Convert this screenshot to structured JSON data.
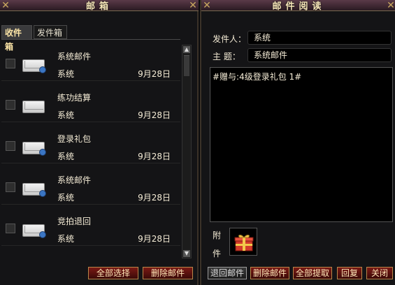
{
  "mailbox": {
    "title": "邮箱",
    "tabs": [
      {
        "label": "收件箱"
      },
      {
        "label": "发件箱"
      }
    ],
    "mails": [
      {
        "subject": "系统邮件",
        "sender": "系统",
        "date": "9月28日",
        "has_seal": true
      },
      {
        "subject": "练功结算",
        "sender": "系统",
        "date": "9月28日",
        "has_seal": false
      },
      {
        "subject": "登录礼包",
        "sender": "系统",
        "date": "9月28日",
        "has_seal": true
      },
      {
        "subject": "系统邮件",
        "sender": "系统",
        "date": "9月28日",
        "has_seal": true
      },
      {
        "subject": "竞拍退回",
        "sender": "系统",
        "date": "9月28日",
        "has_seal": true
      }
    ],
    "buttons": {
      "select_all": "全部选择",
      "delete": "删除邮件"
    }
  },
  "reader": {
    "title": "邮件阅读",
    "sender_label": "发件人：",
    "sender_value": "系统",
    "subject_label": "主 题：",
    "subject_value": "系统邮件",
    "body": "#赠与:4级登录礼包 1#",
    "attach_label_1": "附",
    "attach_label_2": "件",
    "buttons": {
      "back": "退回邮件",
      "delete": "删除邮件",
      "collect_all": "全部提取",
      "reply": "回复",
      "close": "关闭"
    }
  },
  "colors": {
    "accent_button": "#7a1a14",
    "button_border": "#b8864a",
    "text": "#f5ecd6"
  }
}
